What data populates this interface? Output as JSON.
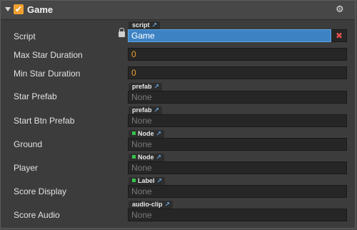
{
  "component": {
    "title": "Game",
    "enabled_mark": "✔",
    "settings_icon": "gear-icon"
  },
  "rows": {
    "script": {
      "label": "Script",
      "type_tag": "script",
      "value": "Game",
      "clear_mark": "✖"
    },
    "max_star_duration": {
      "label": "Max Star Duration",
      "value": "0"
    },
    "min_star_duration": {
      "label": "Min Star Duration",
      "value": "0"
    },
    "star_prefab": {
      "label": "Star Prefab",
      "type_tag": "prefab",
      "value": "None"
    },
    "start_btn_prefab": {
      "label": "Start Btn Prefab",
      "type_tag": "prefab",
      "value": "None"
    },
    "ground": {
      "label": "Ground",
      "type_tag": "Node",
      "value": "None"
    },
    "player": {
      "label": "Player",
      "type_tag": "Node",
      "value": "None"
    },
    "score_display": {
      "label": "Score Display",
      "type_tag": "Label",
      "value": "None"
    },
    "score_audio": {
      "label": "Score Audio",
      "type_tag": "audio-clip",
      "value": "None"
    }
  },
  "colors": {
    "accent": "#f0a030",
    "selected_field": "#3d83c4",
    "node_marker": "#35c24a"
  }
}
